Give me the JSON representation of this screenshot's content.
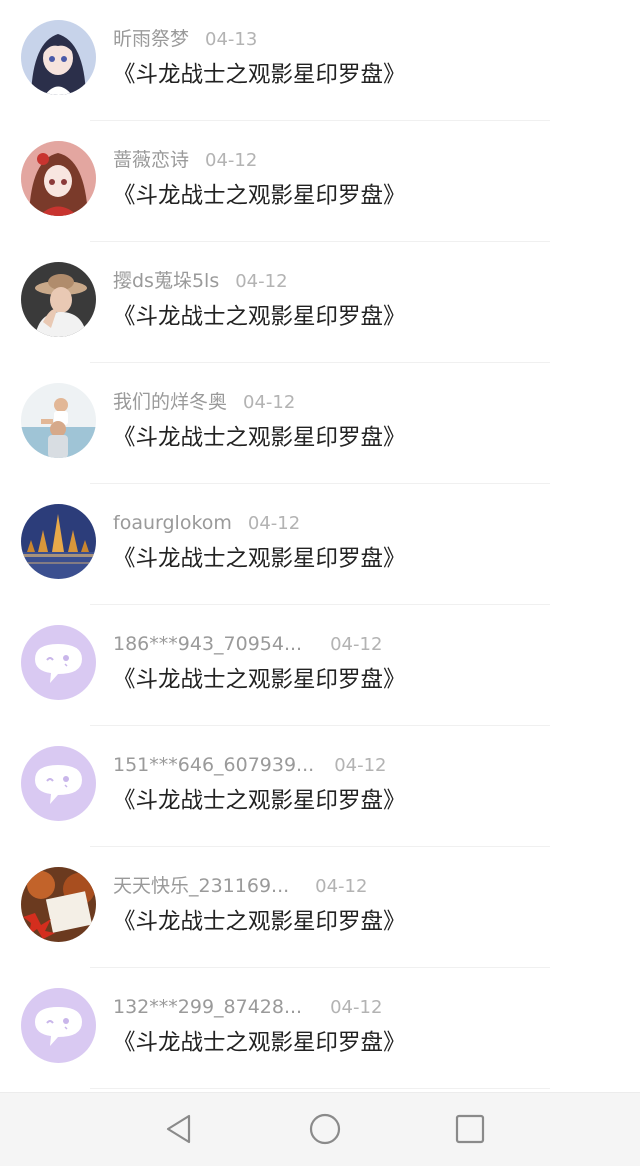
{
  "list": {
    "items": [
      {
        "name": "昕雨祭梦",
        "date": "04-13",
        "title": "《斗龙战士之观影星印罗盘》",
        "avatar": "anime-girl-dark-hair"
      },
      {
        "name": "蔷薇恋诗",
        "date": "04-12",
        "title": "《斗龙战士之观影星印罗盘》",
        "avatar": "anime-girl-red"
      },
      {
        "name": "撄ds蒐垛5ls",
        "date": "04-12",
        "title": "《斗龙战士之观影星印罗盘》",
        "avatar": "woman-hat-photo"
      },
      {
        "name": "我们的烊冬奥",
        "date": "04-12",
        "title": "《斗龙战士之观影星印罗盘》",
        "avatar": "father-child-photo"
      },
      {
        "name": "foaurglokom",
        "date": "04-12",
        "title": "《斗龙战士之观影星印罗盘》",
        "avatar": "temple-night-photo"
      },
      {
        "name": "186***943_70954...",
        "date": "04-12",
        "title": "《斗龙战士之观影星印罗盘》",
        "avatar": "default-chat-bubble"
      },
      {
        "name": "151***646_607939...",
        "date": "04-12",
        "title": "《斗龙战士之观影星印罗盘》",
        "avatar": "default-chat-bubble"
      },
      {
        "name": "天天快乐_231169...",
        "date": "04-12",
        "title": "《斗龙战士之观影星印罗盘》",
        "avatar": "autumn-leaves-photo"
      },
      {
        "name": "132***299_87428...",
        "date": "04-12",
        "title": "《斗龙战士之观影星印罗盘》",
        "avatar": "default-chat-bubble"
      }
    ]
  },
  "navbar": {
    "icons": [
      "back-triangle-icon",
      "home-circle-icon",
      "recents-square-icon"
    ]
  },
  "colors": {
    "name_text": "#9a9a9a",
    "date_text": "#b3b3b3",
    "title_text": "#222222",
    "default_avatar_bg": "#d9c9f2",
    "navbar_bg": "#f5f5f5",
    "nav_icon": "#8a8a8a"
  }
}
